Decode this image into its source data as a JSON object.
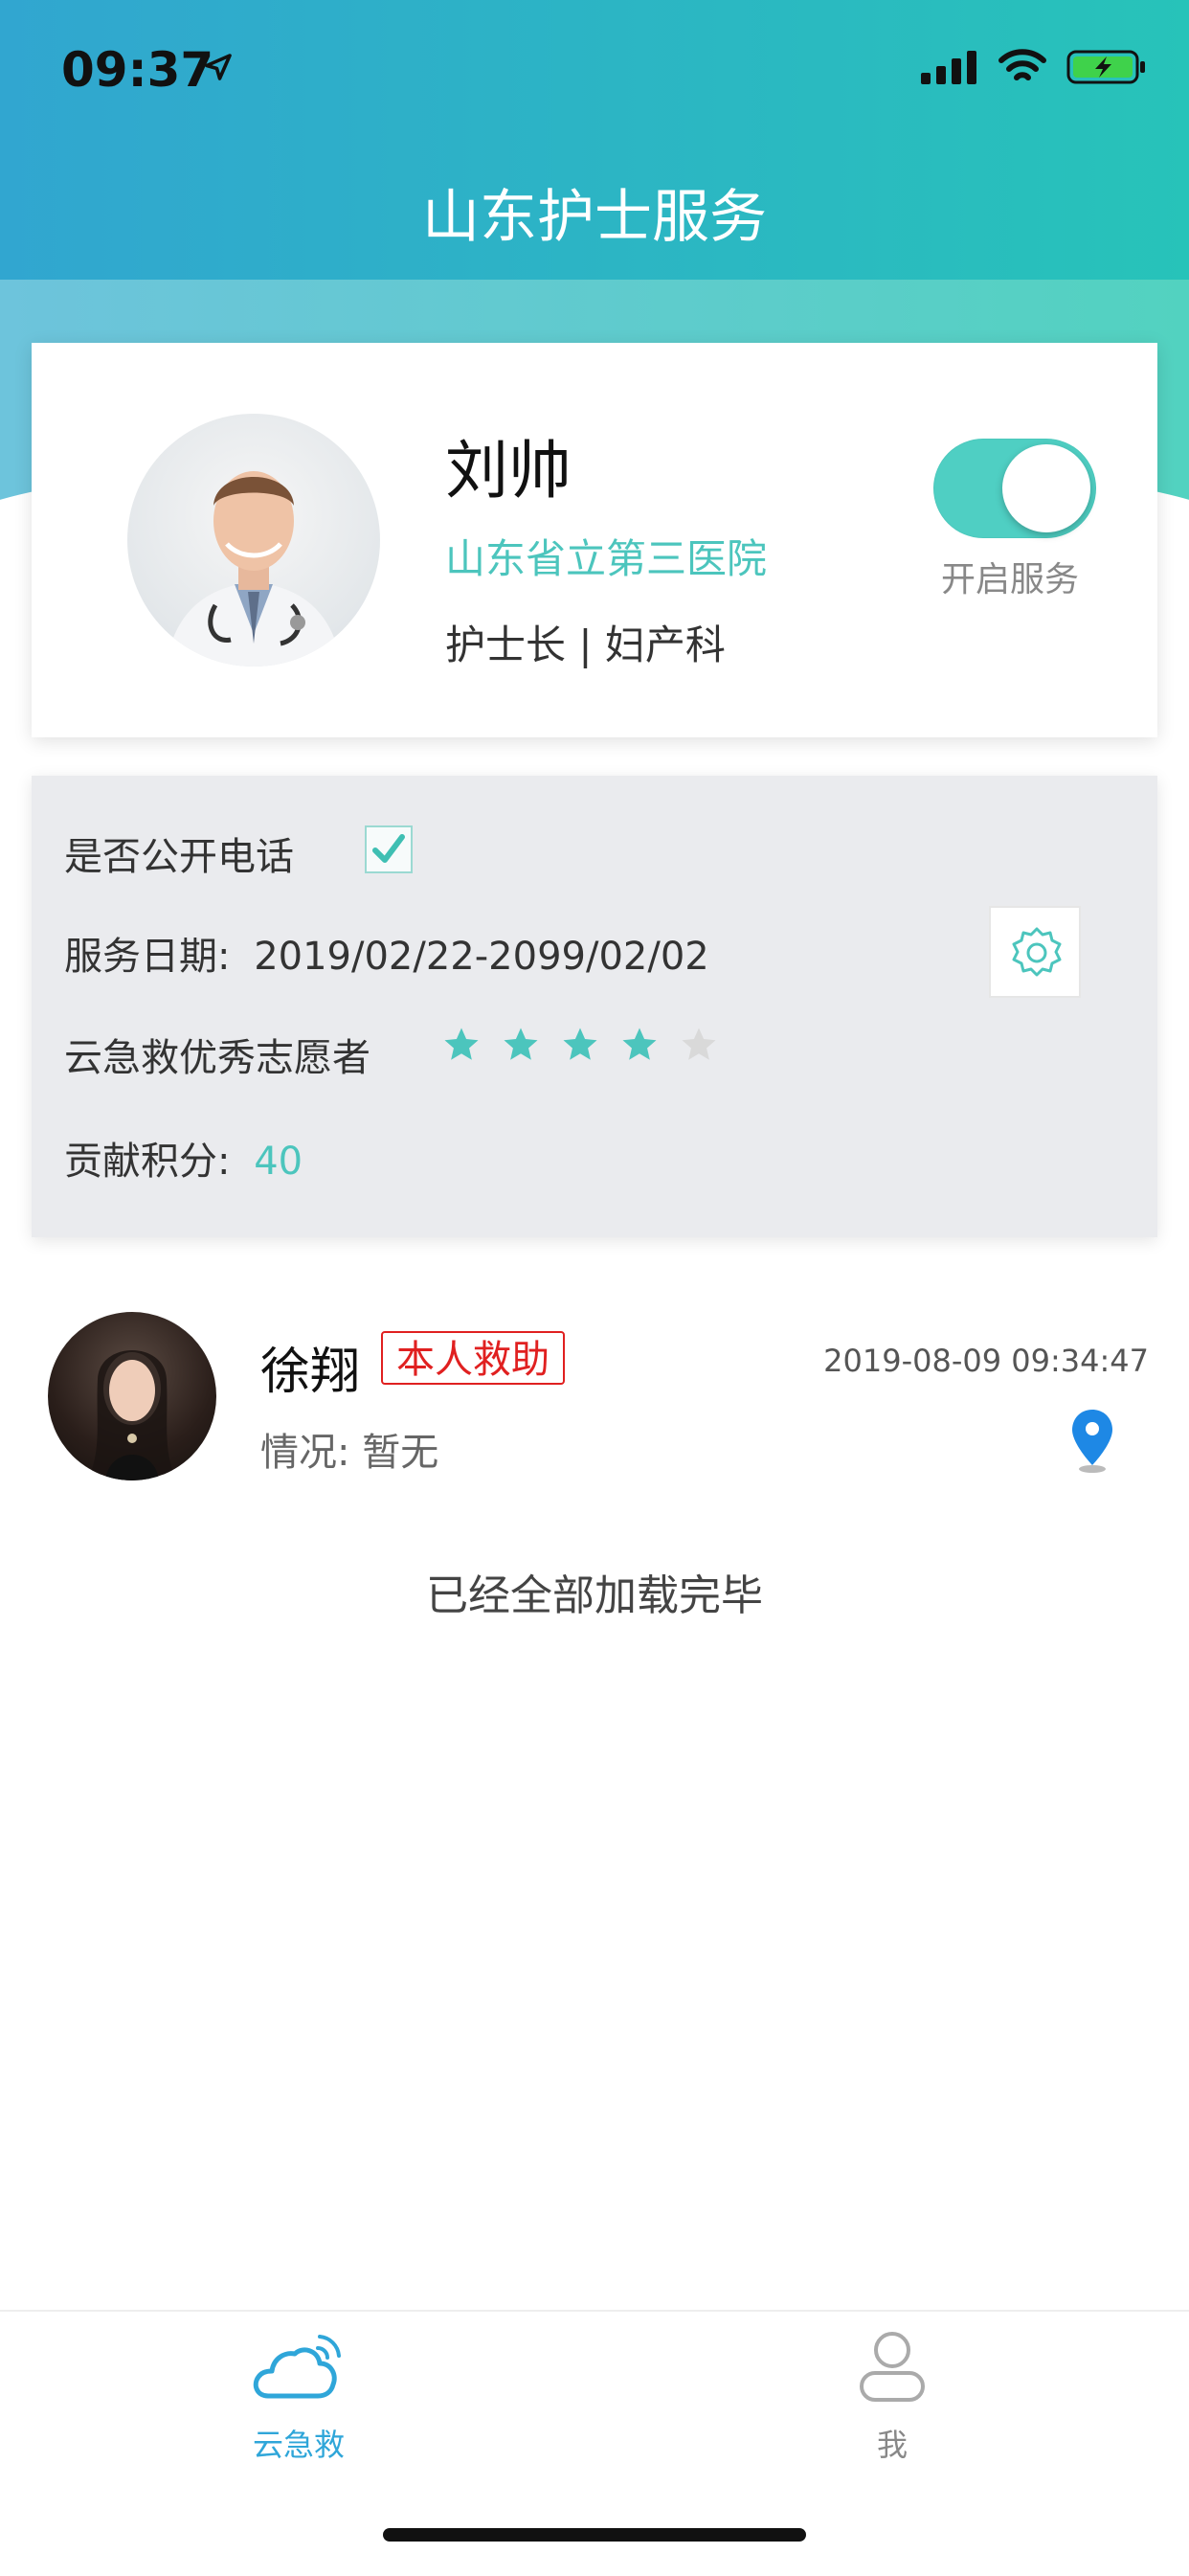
{
  "status_bar": {
    "time": "09:37"
  },
  "header": {
    "title": "山东护士服务"
  },
  "profile": {
    "name": "刘帅",
    "hospital": "山东省立第三医院",
    "role": "护士长 | 妇产科",
    "service_toggle_label": "开启服务",
    "service_on": true
  },
  "info": {
    "public_phone_label": "是否公开电话",
    "public_phone_checked": true,
    "service_date_label": "服务日期:",
    "service_date_value": "2019/02/22-2099/02/02",
    "volunteer_label": "云急救优秀志愿者",
    "rating_stars": 4,
    "rating_max": 5,
    "points_label": "贡献积分:",
    "points_value": "40"
  },
  "records": [
    {
      "name": "徐翔",
      "badge": "本人救助",
      "timestamp": "2019-08-09 09:34:47",
      "status": "情况: 暂无"
    }
  ],
  "end_text": "已经全部加载完毕",
  "tabbar": {
    "tabs": [
      {
        "label": "云急救",
        "icon": "cloud-signal-icon",
        "active": true
      },
      {
        "label": "我",
        "icon": "person-icon",
        "active": false
      }
    ]
  },
  "colors": {
    "accent": "#4cc5bd",
    "header_start": "#31a6d0",
    "header_end": "#27c3b9",
    "badge_red": "#e02020",
    "tab_active": "#2fa6d9"
  }
}
